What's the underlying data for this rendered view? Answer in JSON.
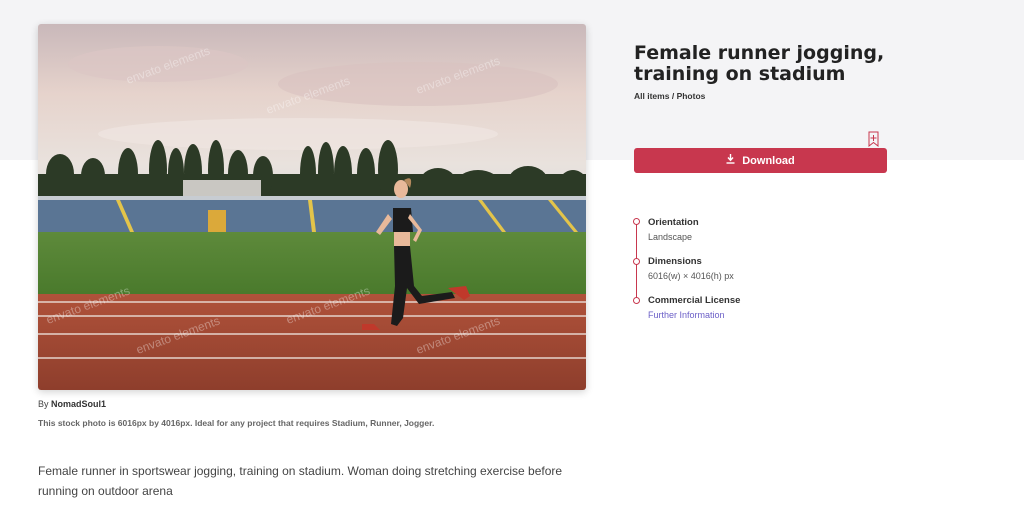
{
  "photo": {
    "alt": "Female runner jogging, training on stadium",
    "watermark": "envato elements"
  },
  "byline": {
    "prefix": "By",
    "author": "NomadSoul1"
  },
  "caption": "This stock photo is 6016px by 4016px. Ideal for any project that requires Stadium, Runner, Jogger.",
  "description": "Female runner in sportswear jogging, training on stadium. Woman doing stretching exercise before running on outdoor arena",
  "title": "Female runner jogging, training on stadium",
  "breadcrumb": {
    "all": "All items",
    "separator": "/",
    "category": "Photos"
  },
  "download": {
    "label": "Download",
    "icon": "download-icon"
  },
  "bookmark": {
    "icon": "bookmark-add-icon"
  },
  "details": {
    "orientation": {
      "label": "Orientation",
      "value": "Landscape"
    },
    "dimensions": {
      "label": "Dimensions",
      "value": "6016(w) × 4016(h) px"
    },
    "license": {
      "label": "Commercial License",
      "link": "Further Information"
    }
  },
  "colors": {
    "accent": "#c8374e",
    "link": "#6b5fc7",
    "band": "#f4f4f6"
  }
}
